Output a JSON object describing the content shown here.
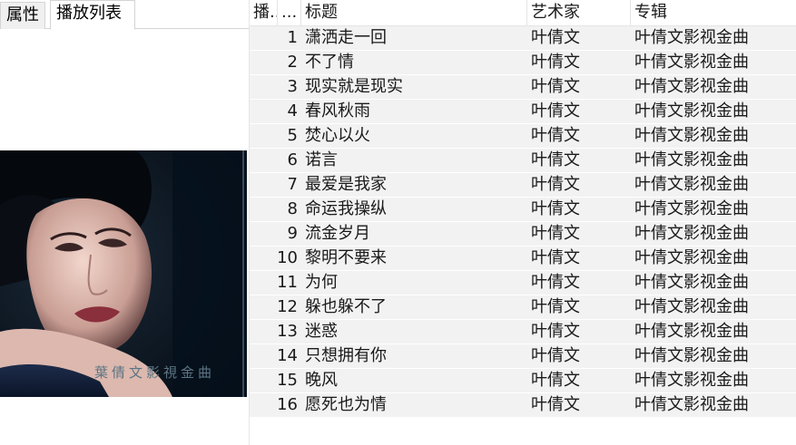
{
  "tabs": [
    {
      "label": "属性",
      "active": false
    },
    {
      "label": "播放列表",
      "active": true
    }
  ],
  "cover": {
    "caption": "葉倩文影視金曲"
  },
  "playlist": {
    "columns": {
      "number": "播...",
      "dots": "...",
      "title": "标题",
      "artist": "艺术家",
      "album": "专辑"
    },
    "rows": [
      {
        "index": "1",
        "title": "潇洒走一回",
        "artist": "叶倩文",
        "album": "叶倩文影视金曲"
      },
      {
        "index": "2",
        "title": "不了情",
        "artist": "叶倩文",
        "album": "叶倩文影视金曲"
      },
      {
        "index": "3",
        "title": "现实就是现实",
        "artist": "叶倩文",
        "album": "叶倩文影视金曲"
      },
      {
        "index": "4",
        "title": "春风秋雨",
        "artist": "叶倩文",
        "album": "叶倩文影视金曲"
      },
      {
        "index": "5",
        "title": "焚心以火",
        "artist": "叶倩文",
        "album": "叶倩文影视金曲"
      },
      {
        "index": "6",
        "title": "诺言",
        "artist": "叶倩文",
        "album": "叶倩文影视金曲"
      },
      {
        "index": "7",
        "title": "最爱是我家",
        "artist": "叶倩文",
        "album": "叶倩文影视金曲"
      },
      {
        "index": "8",
        "title": "命运我操纵",
        "artist": "叶倩文",
        "album": "叶倩文影视金曲"
      },
      {
        "index": "9",
        "title": "流金岁月",
        "artist": "叶倩文",
        "album": "叶倩文影视金曲"
      },
      {
        "index": "10",
        "title": "黎明不要来",
        "artist": "叶倩文",
        "album": "叶倩文影视金曲"
      },
      {
        "index": "11",
        "title": "为何",
        "artist": "叶倩文",
        "album": "叶倩文影视金曲"
      },
      {
        "index": "12",
        "title": "躲也躲不了",
        "artist": "叶倩文",
        "album": "叶倩文影视金曲"
      },
      {
        "index": "13",
        "title": "迷惑",
        "artist": "叶倩文",
        "album": "叶倩文影视金曲"
      },
      {
        "index": "14",
        "title": "只想拥有你",
        "artist": "叶倩文",
        "album": "叶倩文影视金曲"
      },
      {
        "index": "15",
        "title": "晚风",
        "artist": "叶倩文",
        "album": "叶倩文影视金曲"
      },
      {
        "index": "16",
        "title": "愿死也为情",
        "artist": "叶倩文",
        "album": "叶倩文影视金曲"
      }
    ]
  }
}
